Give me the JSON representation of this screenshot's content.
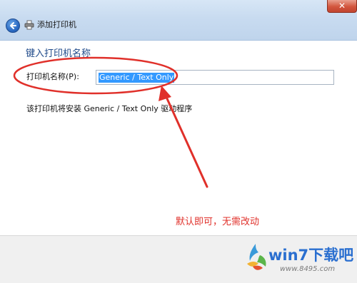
{
  "window": {
    "title": "添加打印机",
    "close_glyph": "✕"
  },
  "page": {
    "heading": "键入打印机名称",
    "printer_name_label": "打印机名称(P):",
    "printer_name_value": "Generic / Text Only",
    "driver_note": "该打印机将安装 Generic / Text Only 驱动程序"
  },
  "annotation": {
    "text": "默认即可，无需改动",
    "color": "#e0302a"
  },
  "watermark": {
    "site": "win7下载吧",
    "url": "www.8495.com"
  },
  "colors": {
    "heading_blue": "#1f4a8a",
    "selection_blue": "#3399ff",
    "close_red": "#d2553d"
  },
  "icons": [
    "back-arrow-icon",
    "printer-icon",
    "close-icon",
    "windows-logo-icon"
  ]
}
